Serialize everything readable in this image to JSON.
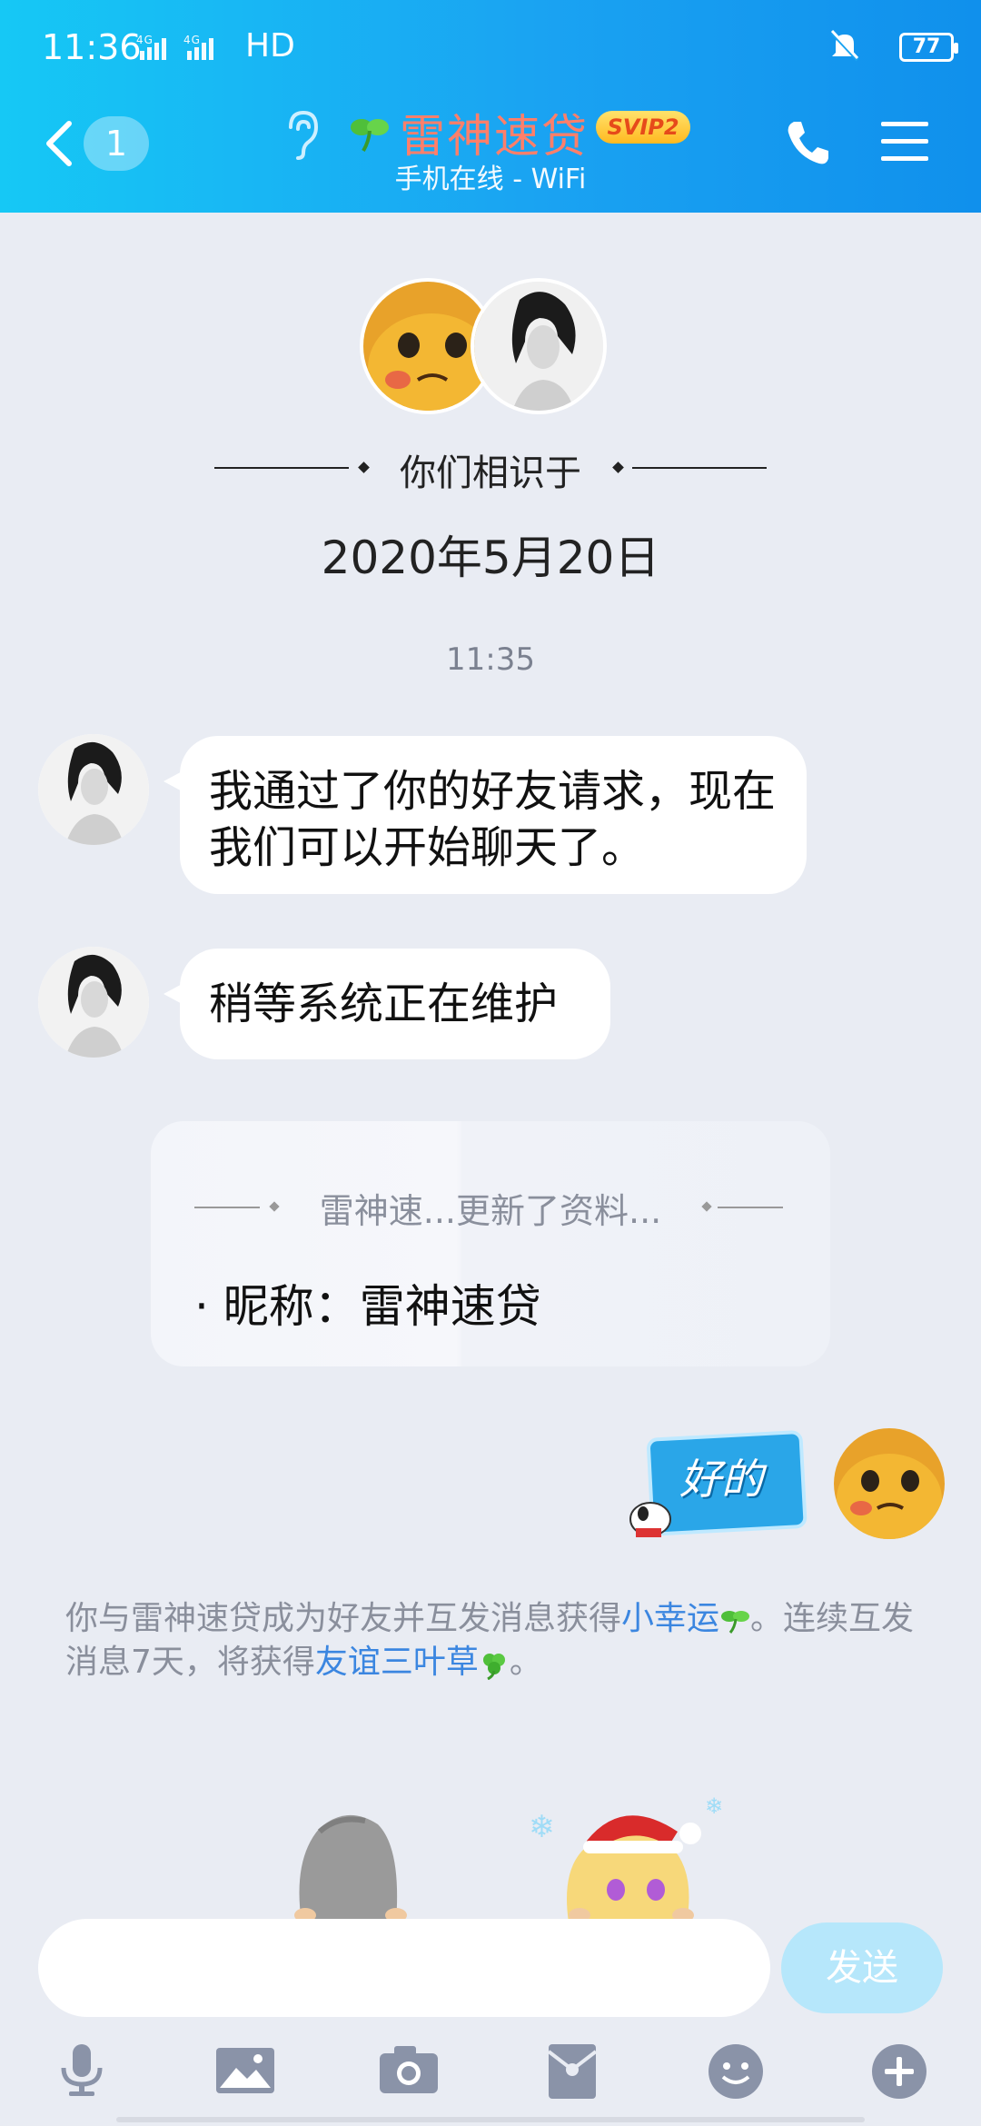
{
  "status_bar": {
    "time": "11:36",
    "network": "4G 4G",
    "hd": "HD",
    "battery": "77"
  },
  "header": {
    "unread_count": "1",
    "title": "雷神速贷",
    "badge": "SVIP2",
    "subtitle": "手机在线 - WiFi"
  },
  "meet": {
    "label": "你们相识于",
    "date": "2020年5月20日"
  },
  "messages": {
    "timestamp": "11:35",
    "msg1": "我通过了你的好友请求，现在我们可以开始聊天了。",
    "msg2": "稍等系统正在维护",
    "notice_title": "雷神速...更新了资料...",
    "notice_body": "· 昵称：雷神速贷",
    "sticker_text": "好的"
  },
  "system_tip": {
    "part1": "你与雷神速贷成为好友并互发消息获得",
    "link1": "小幸运",
    "part2": "。连续互发消息7天，将获得",
    "link2": "友谊三叶草",
    "part3": "。"
  },
  "composer": {
    "send_label": "发送"
  },
  "icons": [
    "back-icon",
    "ear-icon",
    "clover-icon",
    "phone-icon",
    "menu-icon",
    "mic-icon",
    "image-icon",
    "camera-icon",
    "red-packet-icon",
    "emoji-icon",
    "plus-icon"
  ],
  "colors": {
    "header_start": "#16c8f5",
    "header_end": "#1090ec",
    "title": "#ff7f6a",
    "link": "#3b86e0",
    "send_button": "#b6e7fb",
    "background": "#e9ecf3"
  }
}
